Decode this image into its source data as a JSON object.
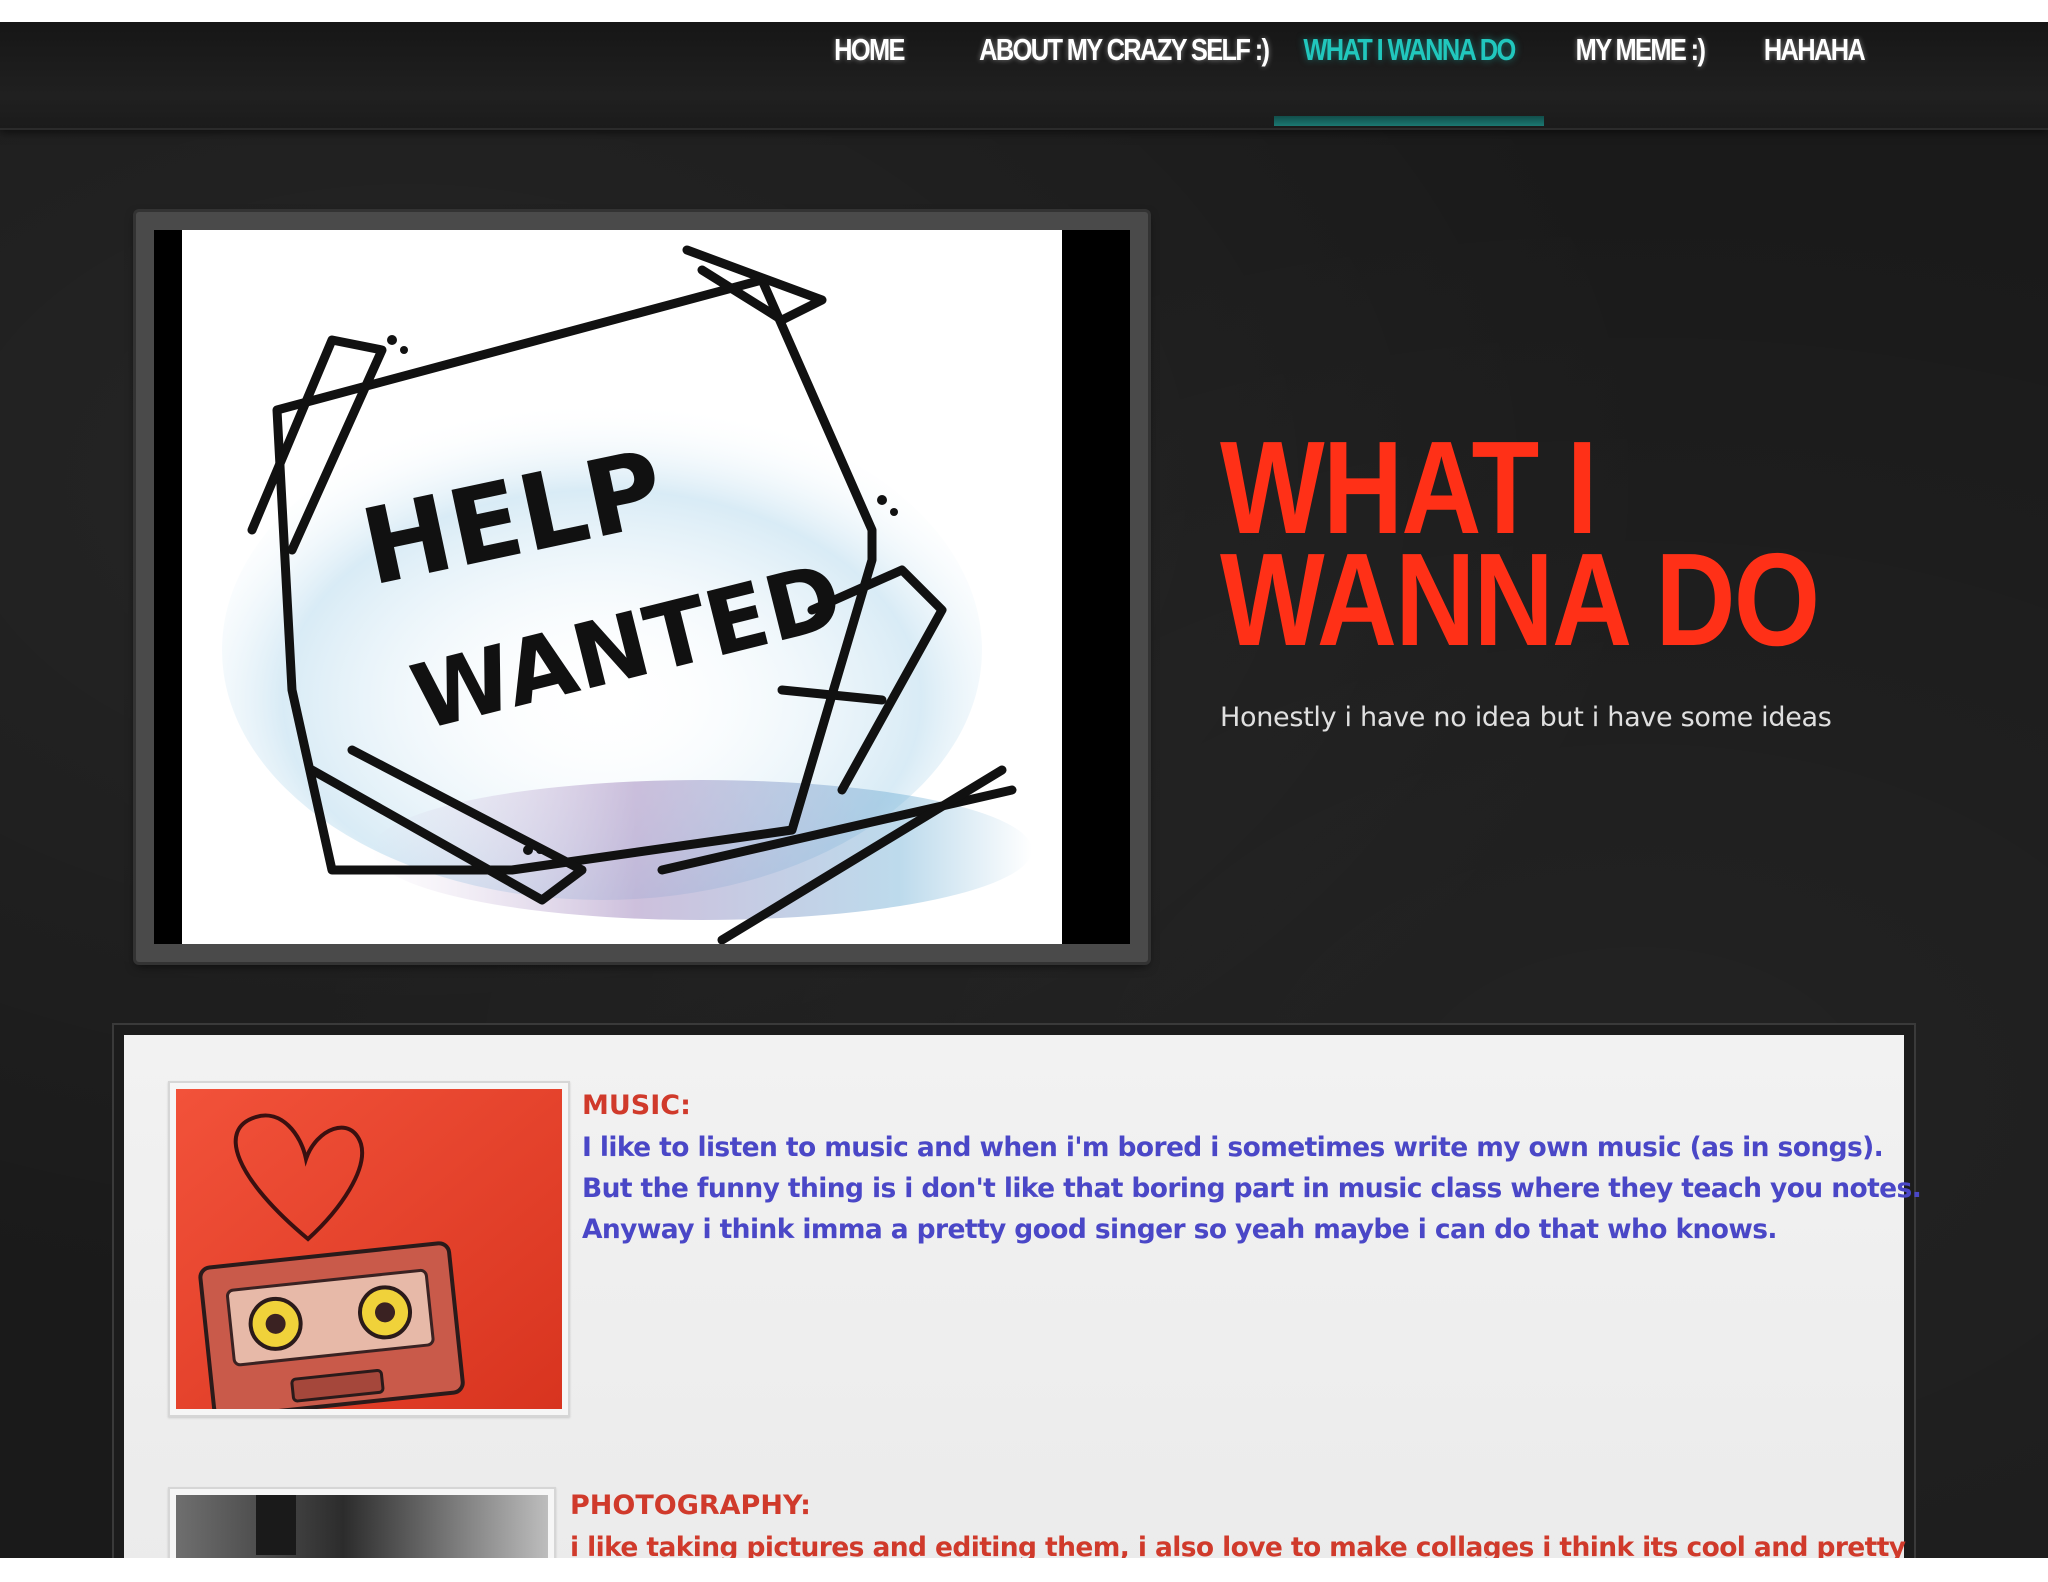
{
  "nav": {
    "items": [
      {
        "label": "HOME",
        "active": false
      },
      {
        "label": "ABOUT MY CRAZY SELF :)",
        "active": false
      },
      {
        "label": "WHAT I WANNA DO",
        "active": true
      },
      {
        "label": "MY MEME :)",
        "active": false
      },
      {
        "label": "HAHAHA",
        "active": false
      }
    ],
    "active_color": "#21c7bd"
  },
  "hero": {
    "image_text": [
      "HELP",
      "WANTED"
    ],
    "title": "WHAT I WANNA DO",
    "subtitle": "Honestly i have no idea but i have some ideas"
  },
  "sections": [
    {
      "heading": "MUSIC:",
      "lines": [
        "I like to listen to music and when i'm bored i sometimes write my own music (as in songs).",
        "But the funny thing is i don't like that boring part in music class where they teach you notes.",
        "Anyway i think imma a pretty good singer so yeah maybe i can do that who knows."
      ]
    },
    {
      "heading": "PHOTOGRAPHY:",
      "lines": [
        "i like taking pictures and editing them, i also love to make collages i think its cool and pretty"
      ]
    }
  ],
  "colors": {
    "title": "#ff3017",
    "section_heading": "#d03a2b",
    "section_text": "#4a47c7",
    "background": "#1a1a1a"
  }
}
